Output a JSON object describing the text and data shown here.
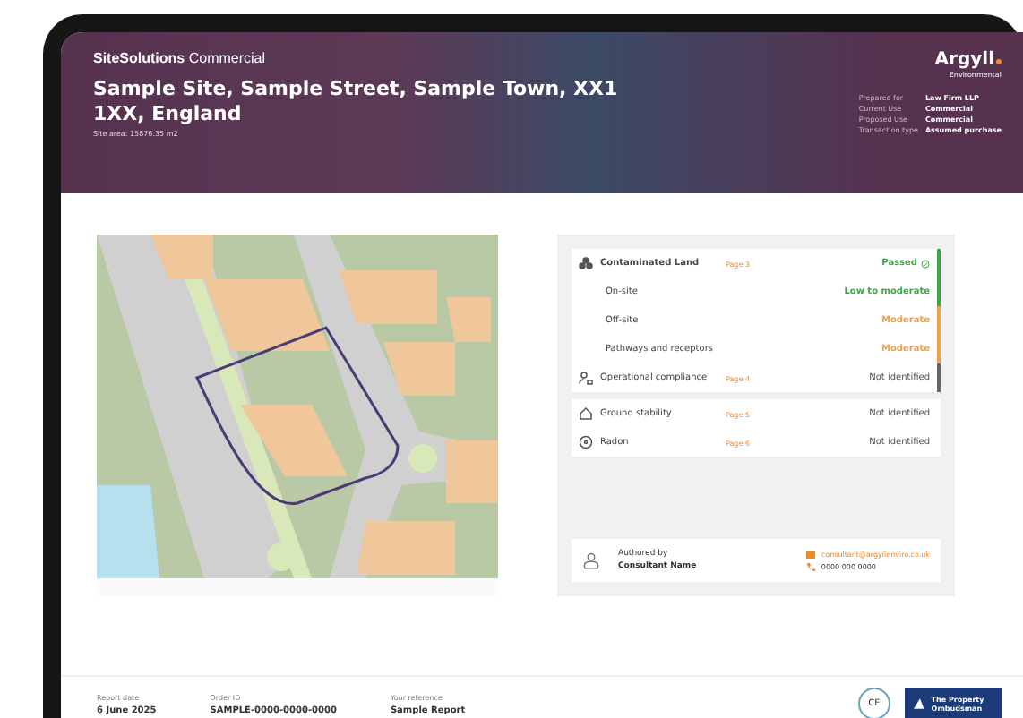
{
  "header": {
    "brand": "SiteSolutions",
    "brand_suffix": "Commercial",
    "title": "Sample Site, Sample Street, Sample Town, XX1 1XX, England",
    "site_area": "Site area: 15876.35 m2",
    "logo": "Argyll",
    "logo_sub": "Environmental",
    "details": [
      {
        "label": "Prepared for",
        "value": "Law Firm LLP"
      },
      {
        "label": "Current Use",
        "value": "Commercial"
      },
      {
        "label": "Proposed Use",
        "value": "Commercial"
      },
      {
        "label": "Transaction type",
        "value": "Assumed purchase"
      }
    ]
  },
  "risks": [
    {
      "kind": "heading",
      "name": "Contaminated Land",
      "page": "Page 3",
      "result": "Passed",
      "color": "#3aa845"
    },
    {
      "kind": "sub",
      "name": "On-site",
      "result": "Low to moderate",
      "color": "#3aa845"
    },
    {
      "kind": "sub",
      "name": "Off-site",
      "result": "Moderate",
      "color": "#f0a040"
    },
    {
      "kind": "sub",
      "name": "Pathways and receptors",
      "result": "Moderate",
      "color": "#f0a040"
    },
    {
      "kind": "item",
      "name": "Operational compliance",
      "page": "Page 4",
      "result": "Not identified",
      "color": "#666666"
    }
  ],
  "other_risks": [
    {
      "name": "Ground stability",
      "page": "Page 5",
      "result": "Not identified"
    },
    {
      "name": "Radon",
      "page": "Page 6",
      "result": "Not identified"
    }
  ],
  "author": {
    "label": "Authored by",
    "name": "Consultant Name",
    "email": "consultant@argyllenviro.co.uk",
    "phone": "0000 000 0000"
  },
  "footer": [
    {
      "label": "Report date",
      "value": "6 June 2025"
    },
    {
      "label": "Order ID",
      "value": "SAMPLE-0000-0000-0000"
    },
    {
      "label": "Your reference",
      "value": "Sample Report"
    }
  ],
  "badges": {
    "ce": "CE",
    "ombudsman": "The Property Ombudsman"
  }
}
